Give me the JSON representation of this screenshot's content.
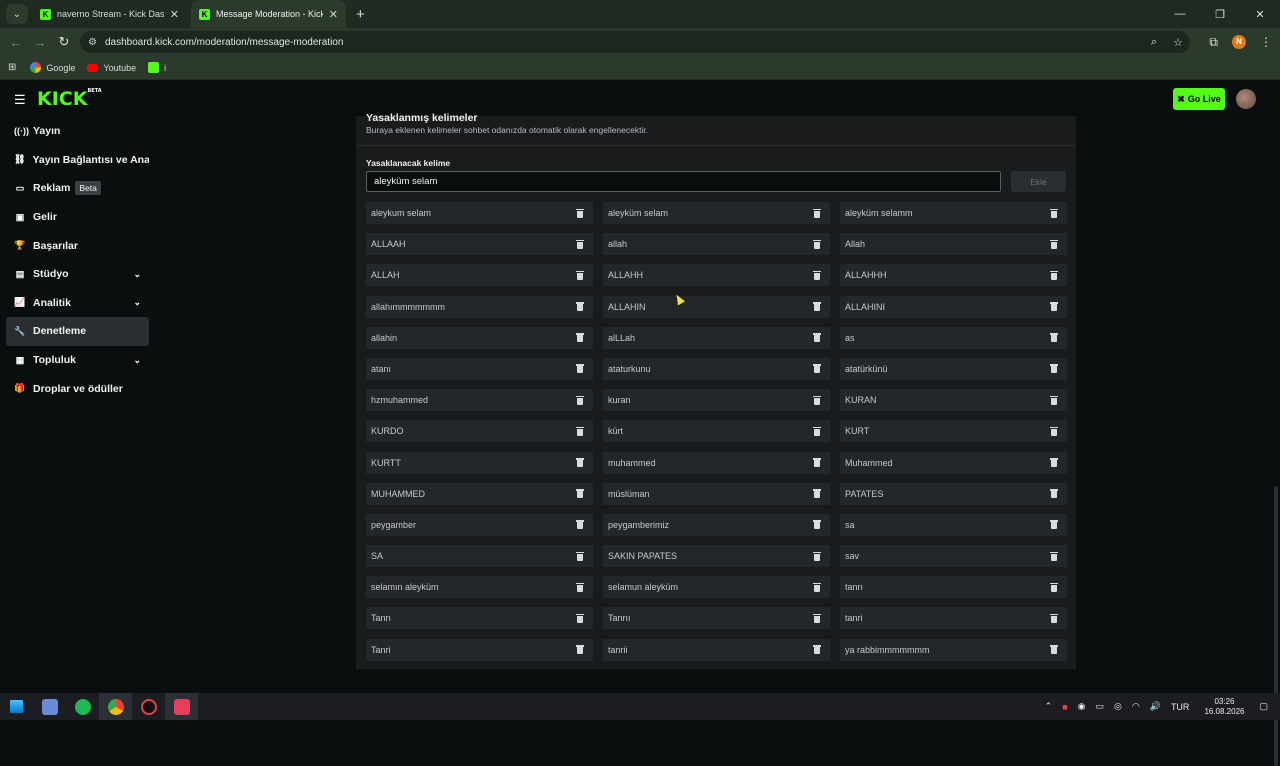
{
  "browser": {
    "tabs": [
      {
        "title": "naverno Stream - Kick Dashboo",
        "active": false
      },
      {
        "title": "Message Moderation - Kick Da",
        "active": true
      }
    ],
    "url": "dashboard.kick.com/moderation/message-moderation",
    "bookmarks": [
      "Google",
      "Youtube",
      "i"
    ],
    "profile_letter": "N",
    "colors": {
      "chrome": "#2b3a2d",
      "kick_green": "#53fc18"
    }
  },
  "topnav": {
    "logo": "KICK",
    "logo_tag": "BETA",
    "go_live": "Go Live"
  },
  "sidebar": {
    "items": [
      {
        "label": "Yayın",
        "icon": "broadcast-icon",
        "glyph": "((·))"
      },
      {
        "label": "Yayın Bağlantısı ve Anahtar",
        "icon": "link-icon",
        "glyph": "⛓"
      },
      {
        "label": "Reklam",
        "icon": "ad-icon",
        "glyph": "▭",
        "badge": "Beta"
      },
      {
        "label": "Gelir",
        "icon": "revenue-icon",
        "glyph": "▣"
      },
      {
        "label": "Başarılar",
        "icon": "trophy-icon",
        "glyph": "🏆"
      },
      {
        "label": "Stüdyo",
        "icon": "studio-icon",
        "glyph": "▤",
        "chevron": true
      },
      {
        "label": "Analitik",
        "icon": "analytics-icon",
        "glyph": "📈",
        "chevron": true
      },
      {
        "label": "Denetleme",
        "icon": "wrench-icon",
        "glyph": "🔧",
        "active": true
      },
      {
        "label": "Topluluk",
        "icon": "community-icon",
        "glyph": "▦",
        "chevron": true
      },
      {
        "label": "Droplar ve ödüller",
        "icon": "gift-icon",
        "glyph": "🎁"
      }
    ]
  },
  "banned_words": {
    "title": "Yasaklanmış kelimeler",
    "subtitle": "Buraya eklenen kelimeler sohbet odanızda otomatik olarak engellenecektir.",
    "field_label": "Yasaklanacak kelime",
    "field_value": "aleyküm selam",
    "add_label": "Ekle",
    "words": [
      "aleykum selam",
      "aleyküm selam",
      "aleyküm selamm",
      "ALLAAH",
      "allah",
      "Allah",
      "ALLAH",
      "ALLAHH",
      "ALLAHHH",
      "allahımmmmmmm",
      "ALLAHIN",
      "ALLAHINI",
      "allahin",
      "alLLah",
      "as",
      "atanı",
      "ataturkunu",
      "atatürkünü",
      "hzmuhammed",
      "kuran",
      "KURAN",
      "KURDO",
      "kürt",
      "KURT",
      "KURTT",
      "muhammed",
      "Muhammed",
      "MUHAMMED",
      "müslüman",
      "PATATES",
      "peygamber",
      "peygamberimiz",
      "sa",
      "SA",
      "SAKIN PAPATES",
      "sav",
      "selamın aleyküm",
      "selamun aleyküm",
      "tanrı",
      "Tanrı",
      "Tanrıı",
      "tanri",
      "Tanri",
      "tanrii",
      "ya rabbimmmmmmm"
    ]
  },
  "taskbar": {
    "language": "TUR",
    "time": "03:26",
    "date": "16.08.2026"
  }
}
